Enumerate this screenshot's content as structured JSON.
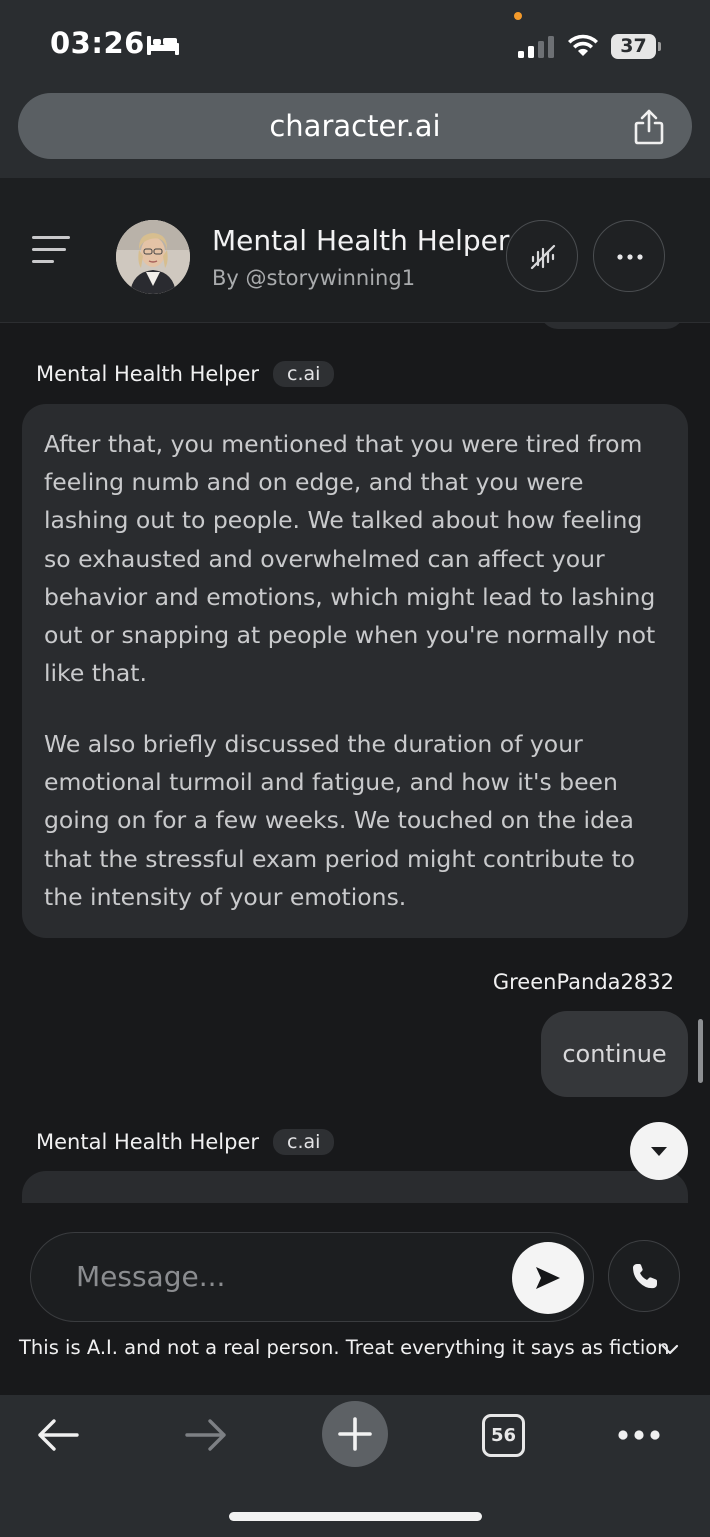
{
  "status_bar": {
    "time": "03:26",
    "battery": "37"
  },
  "browser": {
    "url": "character.ai",
    "tab_count": "56"
  },
  "chat_header": {
    "character_name": "Mental Health Helper",
    "author": "By @storywinning1"
  },
  "messages": [
    {
      "sender": "Mental Health Helper",
      "badge": "c.ai",
      "paragraphs": [
        [
          "After that, you mentioned that you were tired from",
          "feeling numb and on edge, and that you were",
          "lashing out to people. We talked about how feeling",
          "so exhausted and overwhelmed can affect your",
          "behavior and emotions, which might lead to lashing",
          "out or snapping at people when you're normally not",
          "like that."
        ],
        [
          "We also briefly discussed the duration of your",
          "emotional turmoil and fatigue, and how it's been",
          "going on for a few weeks. We touched on the idea",
          "that the stressful exam period might contribute to",
          "the intensity of your emotions."
        ]
      ]
    },
    {
      "sender": "GreenPanda2832",
      "text": "continue"
    },
    {
      "sender": "Mental Health Helper",
      "badge": "c.ai"
    }
  ],
  "composer": {
    "placeholder": "Message...",
    "disclaimer": "This is A.I. and not a real person. Treat everything it says as fiction"
  },
  "icons": {
    "status": [
      "bed-icon",
      "signal-icon",
      "wifi-icon",
      "battery-icon"
    ],
    "chrome": [
      "share-icon",
      "menu-icon",
      "voice-off-icon",
      "more-icon",
      "chevron-down-icon",
      "send-icon",
      "phone-icon",
      "chevron-down-icon",
      "back-arrow-icon",
      "forward-arrow-icon",
      "plus-icon",
      "tabs-icon",
      "more-icon"
    ]
  },
  "colors": {
    "background": "#18191b",
    "bot_bubble": "#2a2c2f",
    "user_bubble": "#35373a",
    "chrome": "#2a2d30",
    "status_dot": "#f39a2b"
  }
}
